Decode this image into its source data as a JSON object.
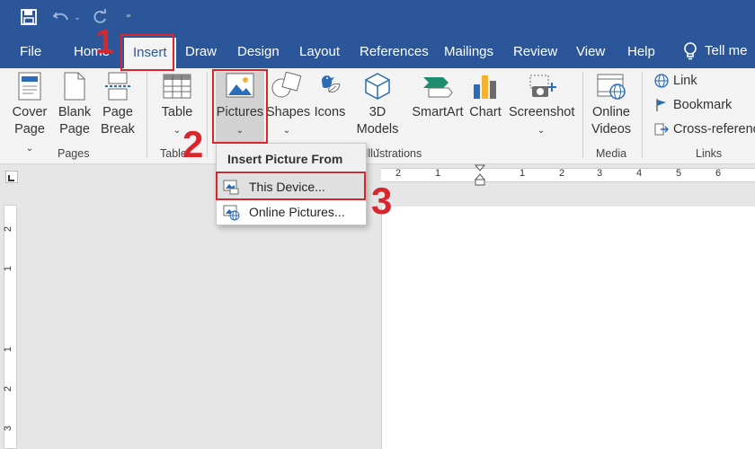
{
  "tabs": [
    "File",
    "Home",
    "Insert",
    "Draw",
    "Design",
    "Layout",
    "References",
    "Mailings",
    "Review",
    "View",
    "Help",
    "Tell me"
  ],
  "ribbon": {
    "pages": {
      "cover_page": [
        "Cover",
        "Page"
      ],
      "blank_page": [
        "Blank",
        "Page"
      ],
      "page_break": [
        "Page",
        "Break"
      ],
      "group_label": "Pages"
    },
    "tables": {
      "table": "Table",
      "group_label": "Tables"
    },
    "illustrations": {
      "pictures": "Pictures",
      "shapes": "Shapes",
      "icons": "Icons",
      "models": [
        "3D",
        "Models"
      ],
      "smartart": "SmartArt",
      "chart": "Chart",
      "screenshot": "Screenshot",
      "group_label": "Illustrations"
    },
    "media": {
      "online_videos": [
        "Online",
        "Videos"
      ],
      "group_label": "Media"
    },
    "links": {
      "link": "Link",
      "bookmark": "Bookmark",
      "cross_reference": "Cross-reference",
      "group_label": "Links"
    }
  },
  "dropdown": {
    "title": "Insert Picture From",
    "this_device": "This Device...",
    "online_pictures": "Online Pictures..."
  },
  "annotations": [
    "1",
    "2",
    "3"
  ],
  "ruler": {
    "h_marks": [
      "2",
      "1",
      "1",
      "2",
      "3",
      "4",
      "5",
      "6"
    ],
    "v_marks": [
      "2",
      "1",
      "1",
      "2",
      "3"
    ]
  },
  "colors": {
    "accent": "#2b579a",
    "annotation_red": "#d9262c"
  }
}
